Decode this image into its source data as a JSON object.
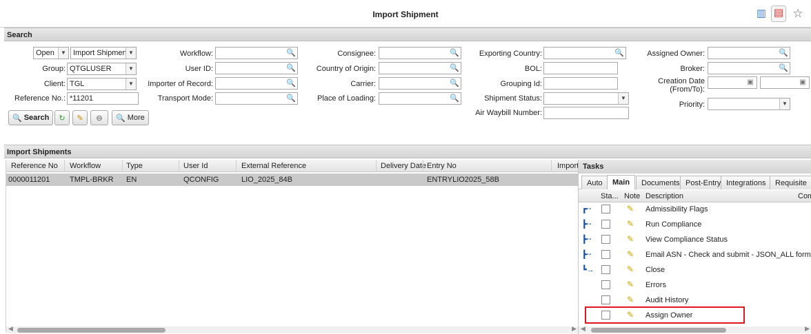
{
  "window": {
    "title": "Import Shipment"
  },
  "search": {
    "header": "Search",
    "status_value": "Open",
    "type_value": "Import Shipment",
    "group_label": "Group:",
    "group_value": "QTGLUSER",
    "client_label": "Client:",
    "client_value": "TGL",
    "refno_label": "Reference No.:",
    "refno_value": "*11201",
    "workflow_label": "Workflow:",
    "userid_label": "User ID:",
    "ior_label": "Importer of Record:",
    "transport_label": "Transport Mode:",
    "consignee_label": "Consignee:",
    "coo_label": "Country of Origin:",
    "carrier_label": "Carrier:",
    "pol_label": "Place of Loading:",
    "exporting_label": "Exporting Country:",
    "bol_label": "BOL:",
    "grouping_label": "Grouping Id:",
    "shipstatus_label": "Shipment Status:",
    "awb_label": "Air Waybill Number:",
    "owner_label": "Assigned Owner:",
    "broker_label": "Broker:",
    "creation_label": "Creation Date",
    "creation_label2": "(From/To):",
    "priority_label": "Priority:",
    "search_button": "Search",
    "more_button": "More"
  },
  "shipments": {
    "header": "Import Shipments",
    "columns": [
      "Reference No",
      "Workflow",
      "Type",
      "User Id",
      "External Reference",
      "Delivery Date",
      "Entry No",
      "Import"
    ],
    "rows": [
      {
        "ref": "0000011201",
        "workflow": "TMPL-BRKR",
        "type": "EN",
        "user": "QCONFIG",
        "ext": "LIO_2025_84B",
        "delivery": "",
        "entry": "ENTRYLIO2025_58B"
      }
    ]
  },
  "tasks": {
    "header": "Tasks",
    "tabs": [
      "Auto",
      "Main",
      "Documents",
      "Post-Entry",
      "Integrations",
      "Requisite"
    ],
    "active_tab": "Main",
    "columns": [
      "Sta...",
      "Note",
      "Description",
      "Com"
    ],
    "items": [
      {
        "desc": "Admissibility Flags",
        "flow": "flow-icon"
      },
      {
        "desc": "Run Compliance",
        "flow": "flow-icon"
      },
      {
        "desc": "View Compliance Status",
        "flow": "flow-icon"
      },
      {
        "desc": "Email ASN - Check and submit - JSON_ALL format",
        "flow": "flow-icon"
      },
      {
        "desc": "Close",
        "flow": "flow-end-icon"
      },
      {
        "desc": "Errors",
        "flow": ""
      },
      {
        "desc": "Audit History",
        "flow": ""
      },
      {
        "desc": "Assign Owner",
        "flow": ""
      }
    ],
    "highlight_color": "#e0161e"
  }
}
